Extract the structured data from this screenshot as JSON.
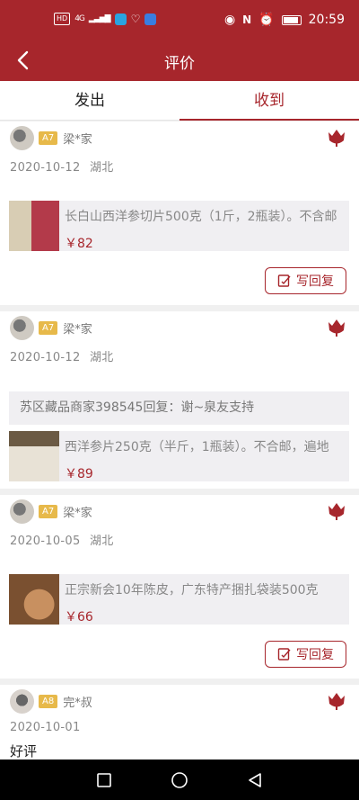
{
  "status_bar": {
    "hd": "HD",
    "signal": "4G",
    "time": "20:59"
  },
  "header": {
    "title": "评价"
  },
  "tabs": [
    {
      "label": "发出"
    },
    {
      "label": "收到"
    }
  ],
  "reviews": [
    {
      "level": "A7",
      "user": "梁*家",
      "date": "2020-10-12",
      "region": "湖北",
      "product": {
        "title": "长白山西洋参切片500克（1斤，2瓶装）。不含邮",
        "price": "￥82"
      },
      "reply_button": "写回复"
    },
    {
      "level": "A7",
      "user": "梁*家",
      "date": "2020-10-12",
      "region": "湖北",
      "reply_text": "苏区藏品商家398545回复：谢~泉友支持",
      "product": {
        "title": "西洋参片250克（半斤，1瓶装）。不合邮，遍地",
        "price": "￥89"
      }
    },
    {
      "level": "A7",
      "user": "梁*家",
      "date": "2020-10-05",
      "region": "湖北",
      "product": {
        "title": "正宗新会10年陈皮，广东特产捆扎袋装500克",
        "price": "￥66"
      },
      "reply_button": "写回复"
    },
    {
      "level": "A8",
      "user": "完*叔",
      "date": "2020-10-01",
      "comment": "好评"
    }
  ],
  "colors": {
    "brand": "#a7262c",
    "level_badge": "#e7b94a"
  }
}
